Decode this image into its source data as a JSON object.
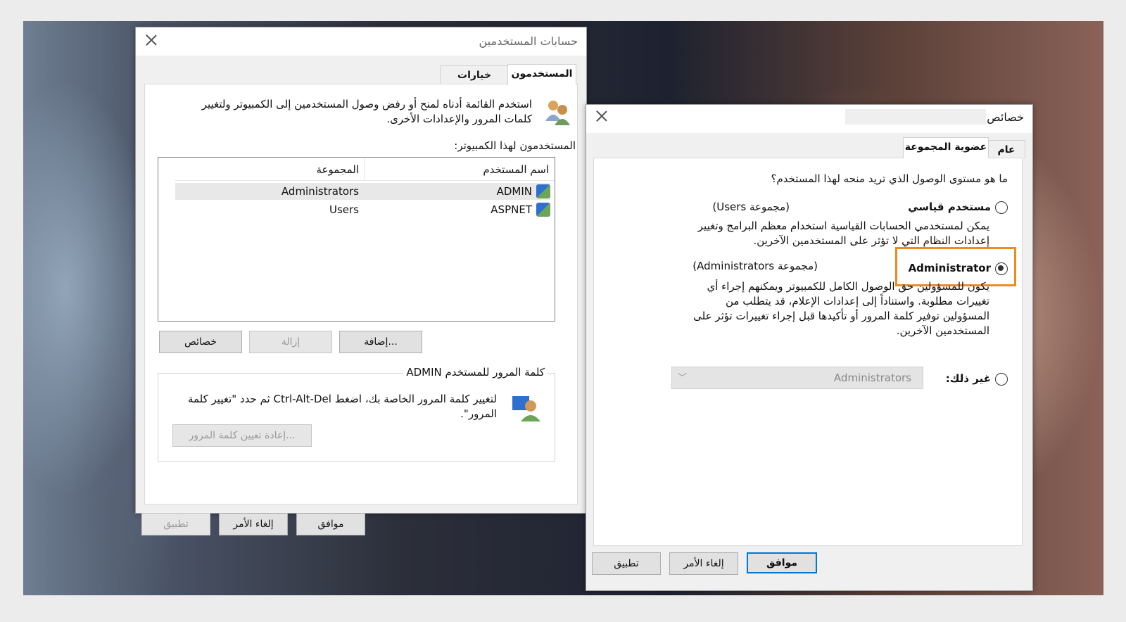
{
  "user_accounts": {
    "title": "حسابات المستخدمين",
    "tabs": [
      "المستخدمون",
      "خيارات متقدمة"
    ],
    "intro": "استخدم القائمة أدناه لمنح أو رفض وصول المستخدمين إلى الكمبيوتر ولتغيير كلمات المرور والإعدادات الأخرى.",
    "users_label": "المستخدمون لهذا الكمبيوتر:",
    "columns": {
      "username": "اسم المستخدم",
      "group": "المجموعة"
    },
    "rows": [
      {
        "username": "ADMIN",
        "group": "Administrators"
      },
      {
        "username": "ASPNET",
        "group": "Users"
      }
    ],
    "buttons": {
      "add": "إضافة...",
      "remove": "إزالة",
      "properties": "خصائص"
    },
    "password_group_label": "كلمة المرور للمستخدم ADMIN",
    "password_text": "لتغيير كلمة المرور الخاصة بك، اضغط Ctrl-Alt-Del ثم حدد \"تغيير كلمة المرور\".",
    "reset_password": "إعادة تعيين كلمة المرور...",
    "footer": {
      "ok": "موافق",
      "cancel": "إلغاء الأمر",
      "apply": "تطبيق"
    }
  },
  "properties": {
    "title": "خصائص",
    "tabs": [
      "عام",
      "عضوية المجموعة"
    ],
    "question": "ما هو مستوى الوصول الذي تريد منحه لهذا المستخدم؟",
    "standard": {
      "label": "مستخدم قياسي",
      "group": "(مجموعة Users)",
      "desc": "يمكن لمستخدمي الحسابات القياسية استخدام معظم البرامج وتغيير إعدادات النظام التي لا تؤثر على المستخدمين الآخرين."
    },
    "admin": {
      "label": "Administrator",
      "group": "(مجموعة Administrators)",
      "desc": "يكون للمسؤولين حق الوصول الكامل للكمبيوتر ويمكنهم إجراء أي تغييرات مطلوبة. واستناداً إلى إعدادات الإعلام، قد يتطلب من المسؤولين توفير كلمة المرور أو تأكيدها قبل إجراء تغييرات تؤثر على المستخدمين الآخرين."
    },
    "other": {
      "label": "غير ذلك:",
      "select_value": "Administrators"
    },
    "footer": {
      "ok": "موافق",
      "cancel": "إلغاء الأمر",
      "apply": "تطبيق"
    }
  },
  "colors": {
    "highlight": "#f08a1e",
    "accent": "#0078d7"
  }
}
